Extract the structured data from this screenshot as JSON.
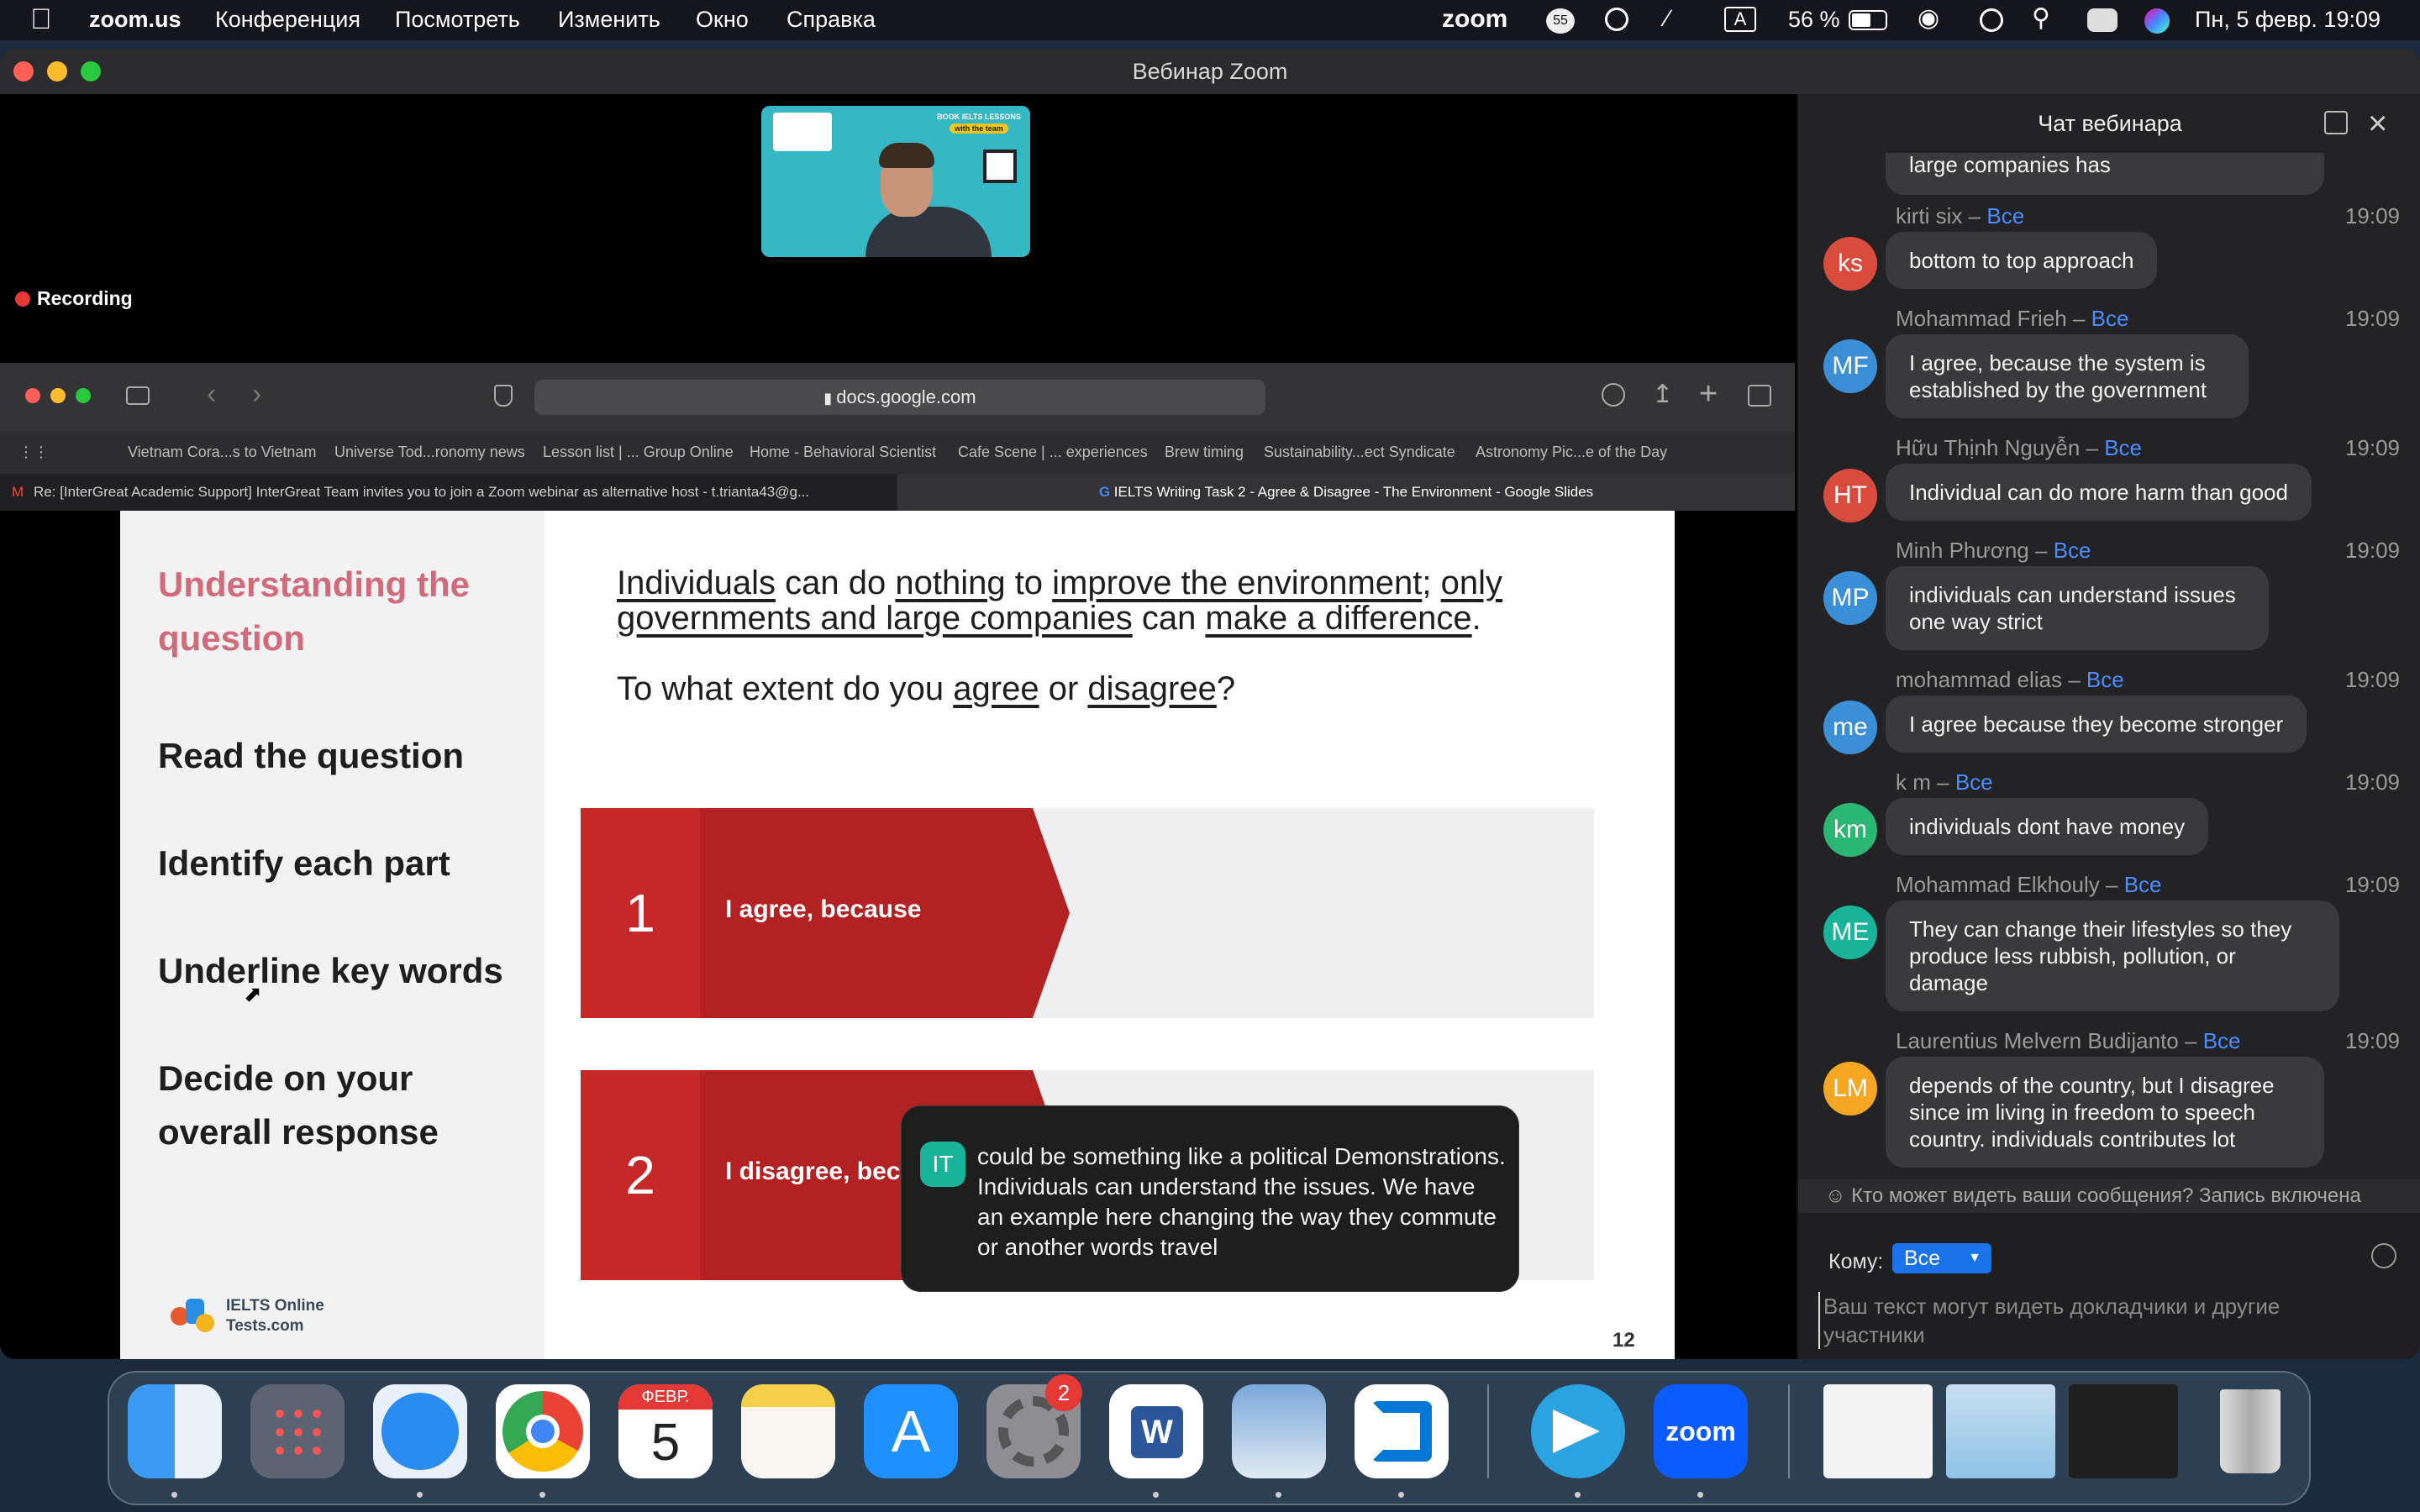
{
  "menubar": {
    "app": "zoom.us",
    "items": [
      "Конференция",
      "Посмотреть",
      "Изменить",
      "Окно",
      "Справка"
    ],
    "zoom_logo": "zoom",
    "badge": "55",
    "battery": "56 %",
    "input_lang": "A",
    "datetime": "Пн, 5 февр.  19:09"
  },
  "window": {
    "title": "Вебинар Zoom"
  },
  "video": {
    "recording": "Recording",
    "ad_lines": [
      "BOOK IELTS LESSONS",
      "with the team"
    ]
  },
  "browser": {
    "url": "docs.google.com",
    "bookmarks": [
      "Vietnam Cora...s to Vietnam",
      "Universe Tod...ronomy news",
      "Lesson list | ... Group Online",
      "Home - Behavioral Scientist",
      "Cafe Scene | ... experiences",
      "Brew timing",
      "Sustainability...ect Syndicate",
      "Astronomy Pic...e of the Day"
    ],
    "tab1": "Re: [InterGreat Academic Support] InterGreat Team invites you to join a Zoom webinar as alternative host - t.trianta43@g...",
    "tab2": "IELTS Writing Task 2 - Agree & Disagree - The Environment - Google Slides"
  },
  "slide": {
    "heading": "Understanding the question",
    "steps": [
      "Read the question",
      "Identify each part",
      "Underline key words",
      "Decide on your overall response"
    ],
    "q1_words": [
      "Individuals",
      " can do ",
      "nothing",
      " to ",
      "improve the environment",
      "; ",
      "only"
    ],
    "q2_words": [
      "governments and large companies",
      " can ",
      "make a difference",
      "."
    ],
    "q3_words": [
      "To what extent do you ",
      "agree",
      " or ",
      "disagree",
      "?"
    ],
    "box1_num": "1",
    "box1_text": "I agree, because",
    "box2_num": "2",
    "box2_text": "I disagree, beca",
    "logo_line1": "IELTS Online",
    "logo_line2": "Tests.com",
    "page": "12"
  },
  "popup": {
    "avatar": "IT",
    "text": "could be something like a political Demonstrations. Individuals can understand the issues. We have an example here changing the way they commute or another words travel"
  },
  "chat": {
    "title": "Чат вебинара",
    "top_partial": "large companies has",
    "messages": [
      {
        "initials": "ks",
        "color": "#d94c3d",
        "name": "kirti six",
        "to": "Все",
        "time": "19:09",
        "text": "bottom to top approach"
      },
      {
        "initials": "MF",
        "color": "#3b8fd6",
        "name": "Mohammad Frieh",
        "to": "Все",
        "time": "19:09",
        "text": "I agree, because the system is established by the government"
      },
      {
        "initials": "HT",
        "color": "#d94c3d",
        "name": "Hữu Thịnh Nguyễn",
        "to": "Все",
        "time": "19:09",
        "text": "Individual can do more harm than good"
      },
      {
        "initials": "MP",
        "color": "#3b8fd6",
        "name": "Minh Phương",
        "to": "Все",
        "time": "19:09",
        "text": "individuals can understand issues one way strict"
      },
      {
        "initials": "me",
        "color": "#3b8fd6",
        "name": "mohammad elias",
        "to": "Все",
        "time": "19:09",
        "text": "I agree because they become stronger"
      },
      {
        "initials": "km",
        "color": "#2bb673",
        "name": "k m",
        "to": "Все",
        "time": "19:09",
        "text": "individuals dont have money"
      },
      {
        "initials": "ME",
        "color": "#19b39a",
        "name": "Mohammad Elkhouly",
        "to": "Все",
        "time": "19:09",
        "text": "They can change their lifestyles so they produce less rubbish, pollution, or damage"
      },
      {
        "initials": "LM",
        "color": "#f5a623",
        "name": "Laurentius Melvern Budijanto",
        "to": "Все",
        "time": "19:09",
        "text": "depends of the country, but I disagree since im living in freedom to speech country. individuals contributes lot"
      }
    ],
    "notice": "Кто может видеть ваши сообщения? Запись включена",
    "to_label": "Кому:",
    "to_value": "Все",
    "input_placeholder": "Ваш текст могут видеть докладчики и другие участники"
  },
  "dock": {
    "calendar_month": "ФЕВР.",
    "calendar_day": "5",
    "settings_badge": "2",
    "zoom_label": "zoom"
  }
}
